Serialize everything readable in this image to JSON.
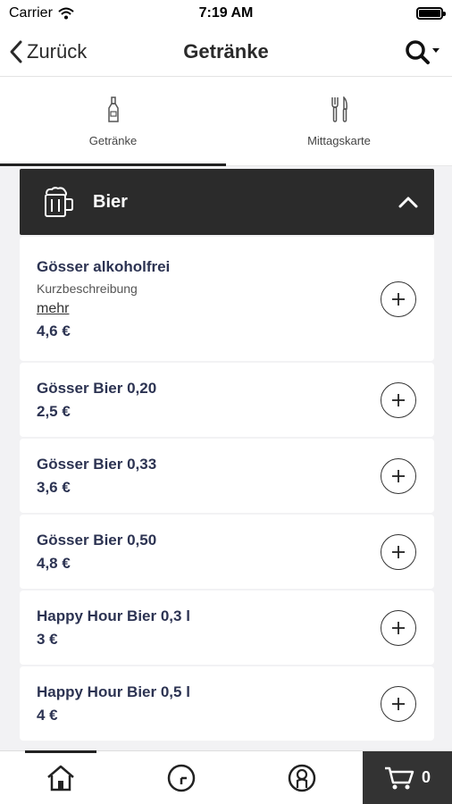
{
  "status_bar": {
    "carrier": "Carrier",
    "time": "7:19 AM"
  },
  "nav": {
    "back_label": "Zurück",
    "title": "Getränke"
  },
  "tabs": [
    {
      "label": "Getränke",
      "icon": "bottle-icon",
      "active": true
    },
    {
      "label": "Mittagskarte",
      "icon": "cutlery-icon",
      "active": false
    }
  ],
  "category": {
    "name": "Bier",
    "icon": "beer-mug-icon"
  },
  "items": [
    {
      "name": "Gösser alkoholfrei",
      "description": "Kurzbeschreibung",
      "more": "mehr",
      "price": "4,6 €"
    },
    {
      "name": "Gösser Bier 0,20",
      "price": "2,5 €"
    },
    {
      "name": "Gösser Bier 0,33",
      "price": "3,6 €"
    },
    {
      "name": "Gösser Bier 0,50",
      "price": "4,8 €"
    },
    {
      "name": "Happy Hour Bier 0,3 l",
      "price": "3 €"
    },
    {
      "name": "Happy Hour Bier 0,5 l",
      "price": "4 €"
    }
  ],
  "bottom_bar": {
    "cart_count": "0"
  },
  "colors": {
    "header_bg": "#2b2b2b",
    "text_primary": "#2c3352",
    "content_bg": "#f2f2f4"
  }
}
